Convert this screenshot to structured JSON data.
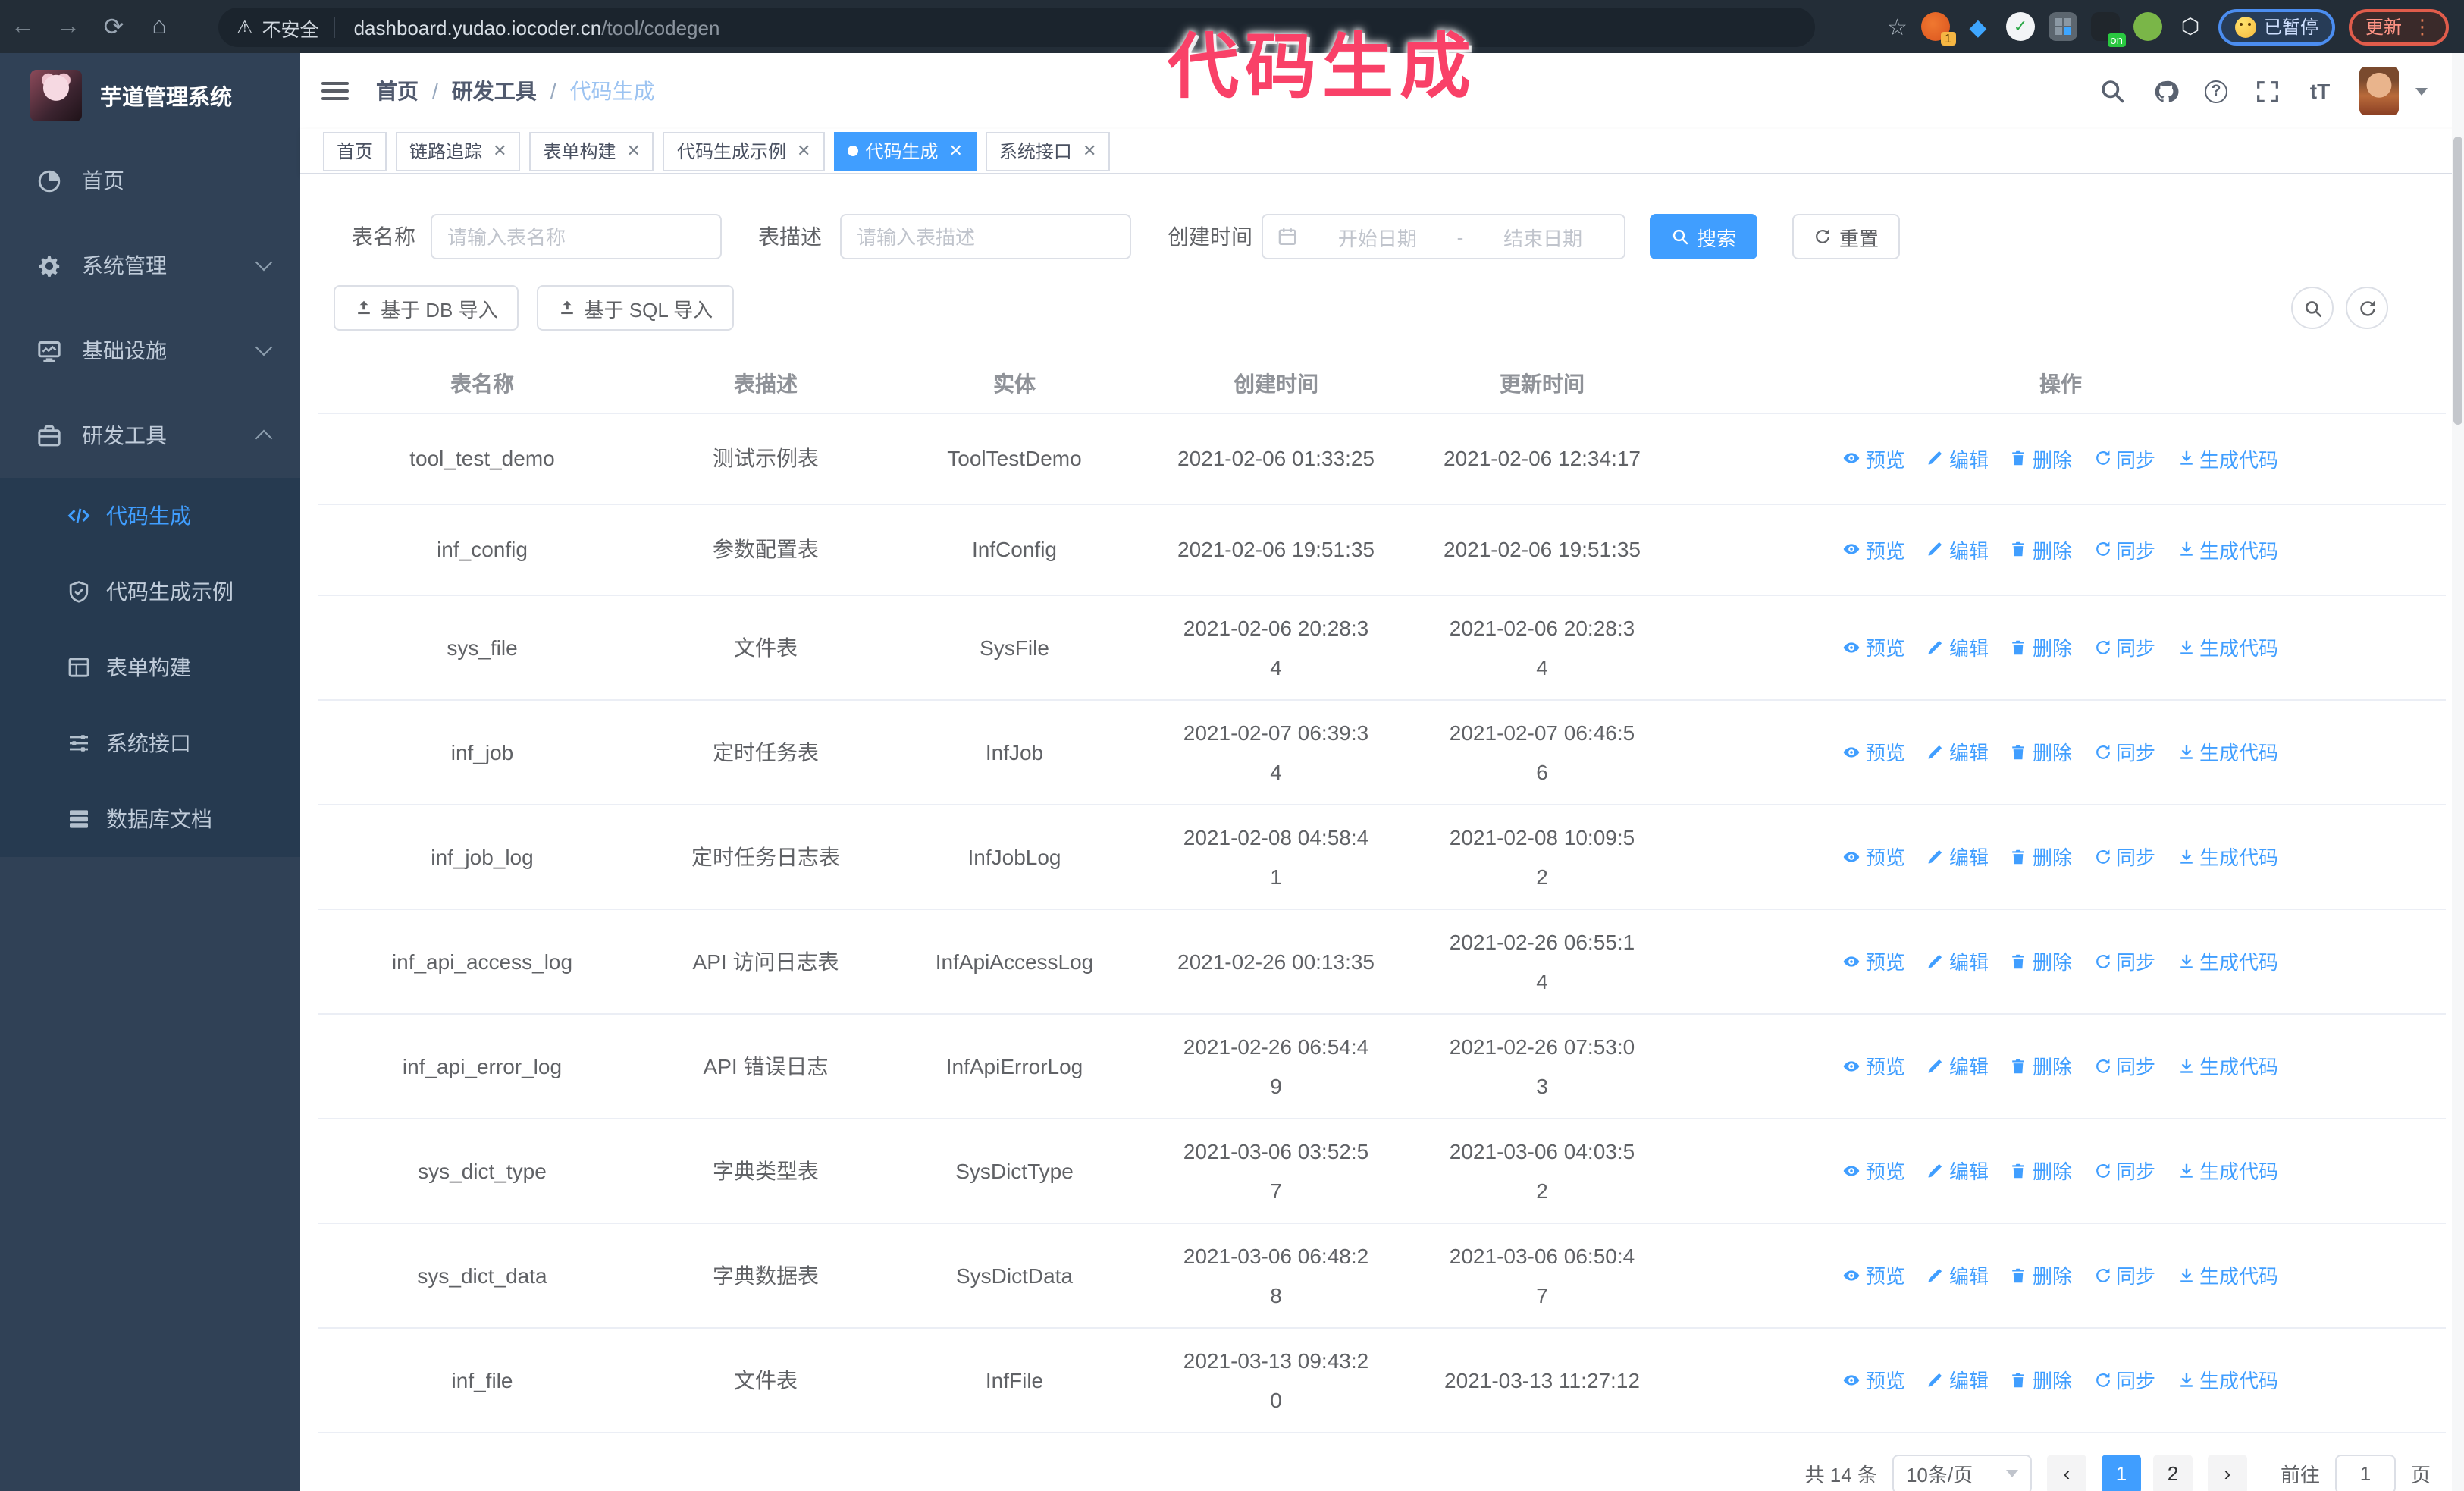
{
  "colors": {
    "accent": "#409eff",
    "annotation_pink": "#f94168",
    "sidebar_bg": "#304156",
    "submenu_bg": "#263a50"
  },
  "overlay": {
    "text": "代码生成"
  },
  "browser": {
    "security_label": "不安全",
    "url_host": "dashboard.yudao.iocoder.cn",
    "url_path": "/tool/codegen",
    "paused_label": "已暂停",
    "update_label": "更新"
  },
  "sidebar": {
    "logo_title": "芋道管理系统",
    "items": [
      {
        "icon": "dashboard-icon",
        "label": "首页"
      },
      {
        "icon": "gear-icon",
        "label": "系统管理",
        "chevron": "down"
      },
      {
        "icon": "monitor-icon",
        "label": "基础设施",
        "chevron": "down"
      },
      {
        "icon": "toolbox-icon",
        "label": "研发工具",
        "chevron": "up",
        "open": true,
        "children": [
          {
            "icon": "code-icon",
            "label": "代码生成",
            "active": true
          },
          {
            "icon": "badge-icon",
            "label": "代码生成示例",
            "active": false
          },
          {
            "icon": "form-icon",
            "label": "表单构建",
            "active": false
          },
          {
            "icon": "sliders-icon",
            "label": "系统接口",
            "active": false
          },
          {
            "icon": "database-icon",
            "label": "数据库文档",
            "active": false
          }
        ]
      }
    ]
  },
  "header": {
    "breadcrumb": [
      "首页",
      "研发工具",
      "代码生成"
    ],
    "separator": "/"
  },
  "tabs": [
    {
      "label": "首页",
      "closable": false,
      "active": false
    },
    {
      "label": "链路追踪",
      "closable": true,
      "active": false
    },
    {
      "label": "表单构建",
      "closable": true,
      "active": false
    },
    {
      "label": "代码生成示例",
      "closable": true,
      "active": false
    },
    {
      "label": "代码生成",
      "closable": true,
      "active": true
    },
    {
      "label": "系统接口",
      "closable": true,
      "active": false
    }
  ],
  "filters": {
    "name_label": "表名称",
    "name_placeholder": "请输入表名称",
    "desc_label": "表描述",
    "desc_placeholder": "请输入表描述",
    "time_label": "创建时间",
    "start_placeholder": "开始日期",
    "range_separator": "-",
    "end_placeholder": "结束日期",
    "search_label": "搜索",
    "reset_label": "重置"
  },
  "toolbar": {
    "import_db_label": "基于 DB 导入",
    "import_sql_label": "基于 SQL 导入"
  },
  "table": {
    "columns": [
      "表名称",
      "表描述",
      "实体",
      "创建时间",
      "更新时间",
      "操作"
    ],
    "actions": [
      {
        "icon": "eye-icon",
        "label": "预览"
      },
      {
        "icon": "edit-icon",
        "label": "编辑"
      },
      {
        "icon": "delete-icon",
        "label": "删除"
      },
      {
        "icon": "sync-icon",
        "label": "同步"
      },
      {
        "icon": "download-icon",
        "label": "生成代码"
      }
    ],
    "rows": [
      {
        "name": "tool_test_demo",
        "desc": "测试示例表",
        "entity": "ToolTestDemo",
        "created": "2021-02-06 01:33:25",
        "updated": "2021-02-06 12:34:17"
      },
      {
        "name": "inf_config",
        "desc": "参数配置表",
        "entity": "InfConfig",
        "created": "2021-02-06 19:51:35",
        "updated": "2021-02-06 19:51:35"
      },
      {
        "name": "sys_file",
        "desc": "文件表",
        "entity": "SysFile",
        "created": "2021-02-06 20:28:3\n4",
        "updated": "2021-02-06 20:28:3\n4"
      },
      {
        "name": "inf_job",
        "desc": "定时任务表",
        "entity": "InfJob",
        "created": "2021-02-07 06:39:3\n4",
        "updated": "2021-02-07 06:46:5\n6"
      },
      {
        "name": "inf_job_log",
        "desc": "定时任务日志表",
        "entity": "InfJobLog",
        "created": "2021-02-08 04:58:4\n1",
        "updated": "2021-02-08 10:09:5\n2"
      },
      {
        "name": "inf_api_access_log",
        "desc": "API 访问日志表",
        "entity": "InfApiAccessLog",
        "created": "2021-02-26 00:13:35",
        "updated": "2021-02-26 06:55:1\n4"
      },
      {
        "name": "inf_api_error_log",
        "desc": "API 错误日志",
        "entity": "InfApiErrorLog",
        "created": "2021-02-26 06:54:4\n9",
        "updated": "2021-02-26 07:53:0\n3"
      },
      {
        "name": "sys_dict_type",
        "desc": "字典类型表",
        "entity": "SysDictType",
        "created": "2021-03-06 03:52:5\n7",
        "updated": "2021-03-06 04:03:5\n2"
      },
      {
        "name": "sys_dict_data",
        "desc": "字典数据表",
        "entity": "SysDictData",
        "created": "2021-03-06 06:48:2\n8",
        "updated": "2021-03-06 06:50:4\n7"
      },
      {
        "name": "inf_file",
        "desc": "文件表",
        "entity": "InfFile",
        "created": "2021-03-13 09:43:2\n0",
        "updated": "2021-03-13 11:27:12"
      }
    ]
  },
  "pagination": {
    "total_label": "共 14 条",
    "page_size_label": "10条/页",
    "prev_label": "‹",
    "next_label": "›",
    "pages": [
      "1",
      "2"
    ],
    "active_page": "1",
    "goto_label": "前往",
    "goto_value": "1",
    "unit_label": "页"
  }
}
